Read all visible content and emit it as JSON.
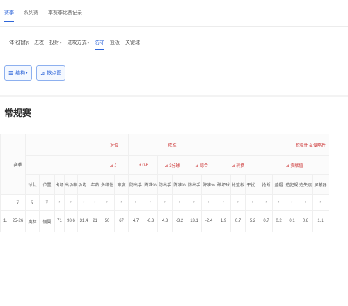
{
  "top_tabs": [
    {
      "label": "赛季",
      "active": true
    },
    {
      "label": "系列赛",
      "active": false
    },
    {
      "label": "本赛季比赛记录",
      "active": false
    }
  ],
  "sub_tabs": [
    {
      "label": "一体化指标",
      "active": false,
      "caret": ""
    },
    {
      "label": "进攻",
      "active": false,
      "caret": ""
    },
    {
      "label": "投射",
      "active": false,
      "caret": "▾"
    },
    {
      "label": "进攻方式",
      "active": false,
      "caret": "▾"
    },
    {
      "label": "防守",
      "active": true,
      "caret": ""
    },
    {
      "label": "篮板",
      "active": false,
      "caret": ""
    },
    {
      "label": "关键球",
      "active": false,
      "caret": ""
    }
  ],
  "buttons": {
    "structure_label": "结构",
    "scatter_label": "散点图"
  },
  "section_title": "常规赛",
  "table": {
    "group_headers": {
      "duiwei": "对位",
      "fangshou": "降准",
      "jiji": "积极性 & 侵略性"
    },
    "sub_groups": {
      "duiwei_sub": "⊿ 〉",
      "g1": "⊿ 0-6",
      "g2": "⊿ 3分球",
      "g3": "⊿ 综合",
      "g4": "⊿ 转换",
      "g5": "⊿ 贡献值"
    },
    "columns": {
      "season": "赛季",
      "team": "球队",
      "position": "位置",
      "games": "出场",
      "start_rate": "出场率",
      "minutes": "场均...",
      "age": "年龄",
      "versatility": "多样性",
      "difficulty": "难度",
      "g1_fg": "防出手",
      "g1_rate": "降准%",
      "g2_fg": "防出手",
      "g2_rate": "降准%",
      "g3_fg": "防出手",
      "g3_rate": "降准%",
      "g4_a": "破坏球",
      "g4_b": "抢篮板",
      "g4_c": "干扰...",
      "g5_a": "抢断",
      "g5_b": "盖帽",
      "g5_c": "造犯规",
      "g5_d": "造失误",
      "g5_e": "屏蔽器"
    },
    "filter_symbol": "⊽",
    "filter_arrow": "›",
    "row": {
      "index": "1.",
      "season": "25-26",
      "team": "奥林",
      "position": "侧翼",
      "games": "71",
      "start_rate": "98.6",
      "minutes": "31.4",
      "age": "21",
      "versatility": "50",
      "difficulty": "67",
      "g1_fg": "4.7",
      "g1_rate": "-6.3",
      "g2_fg": "4.3",
      "g2_rate": "-3.2",
      "g3_fg": "13.1",
      "g3_rate": "-2.4",
      "g4_a": "1.9",
      "g4_b": "0.7",
      "g4_c": "5.2",
      "g5_a": "0.7",
      "g5_b": "0.2",
      "g5_c": "0.1",
      "g5_d": "0.8",
      "g5_e": "1.1"
    }
  }
}
